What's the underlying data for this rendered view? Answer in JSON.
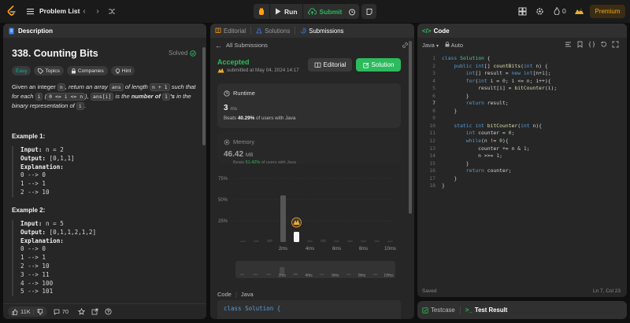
{
  "topbar": {
    "problem_list": "Problem List",
    "run": "Run",
    "submit": "Submit",
    "streak_count": "0",
    "premium": "Premium"
  },
  "description": {
    "tab": "Description",
    "title": "338. Counting Bits",
    "solved": "Solved",
    "tags": [
      "Easy",
      "Topics",
      "Companies",
      "Hint"
    ],
    "text_1": "Given an integer ",
    "chip_n": "n",
    "text_2": ", return an array ",
    "chip_ans": "ans",
    "text_3": " of length ",
    "chip_n1": "n + 1",
    "text_4": " such that for each ",
    "chip_i": "i",
    "text_5": " (",
    "chip_range": "0 <= i <= n",
    "text_6": "), ",
    "chip_ansi": "ans[i]",
    "text_7": " is the ",
    "text_bold": "number of ",
    "chip_1s": "1",
    "text_8": "'s",
    "text_9": " in the binary representation of ",
    "chip_i2": "i",
    "text_10": ".",
    "example1": {
      "title": "Example 1:",
      "input_label": "Input:",
      "input": " n = 2",
      "output_label": "Output:",
      "output": " [0,1,1]",
      "explanation_label": "Explanation:",
      "lines": [
        "0 --> 0",
        "1 --> 1",
        "2 --> 10"
      ]
    },
    "example2": {
      "title": "Example 2:",
      "input_label": "Input:",
      "input": " n = 5",
      "output_label": "Output:",
      "output": " [0,1,1,2,1,2]",
      "explanation_label": "Explanation:",
      "lines": [
        "0 --> 0",
        "1 --> 1",
        "2 --> 10",
        "3 --> 11",
        "4 --> 100",
        "5 --> 101"
      ]
    },
    "likes": "11K",
    "comments": "70"
  },
  "submissions": {
    "tabs": [
      "Editorial",
      "Solutions",
      "Submissions"
    ],
    "all_submissions": "All Submissions",
    "status": "Accepted",
    "submitted_at": "submitted at May 04, 2024 14:17",
    "editorial_btn": "Editorial",
    "solution_btn": "Solution",
    "runtime": {
      "label": "Runtime",
      "value": "3",
      "unit": "ms",
      "beats_prefix": "Beats ",
      "beats_pct": "40.29%",
      "beats_suffix": " of users with Java"
    },
    "memory": {
      "label": "Memory",
      "value": "46.42",
      "unit": "MB",
      "beats_prefix": "Beats ",
      "beats_pct": "51.42%",
      "beats_suffix": " of users with Java"
    },
    "code_label": "Code",
    "code_lang": "Java",
    "code_preview": "class Solution {"
  },
  "chart_data": {
    "type": "bar",
    "ylabel": "",
    "xlabel": "",
    "y_ticks": [
      "75%",
      "50%",
      "25%"
    ],
    "ylim": [
      0,
      75
    ],
    "x_ticks": [
      "2ms",
      "4ms",
      "6ms",
      "8ms",
      "10ms"
    ],
    "x_values": [
      0,
      1,
      2,
      3,
      4,
      5,
      6,
      7,
      8,
      9,
      10,
      11
    ],
    "values": [
      1.5,
      2,
      3,
      55,
      12,
      2,
      3,
      2,
      2,
      2,
      2,
      1.5
    ],
    "highlight_x": 3,
    "grid": true
  },
  "code_panel": {
    "tab": "Code",
    "language": "Java",
    "mode": "Auto",
    "saved": "Saved",
    "cursor": "Ln 7, Col 23"
  },
  "bottom_tabs": {
    "testcase": "Testcase",
    "test_result": "Test Result"
  }
}
